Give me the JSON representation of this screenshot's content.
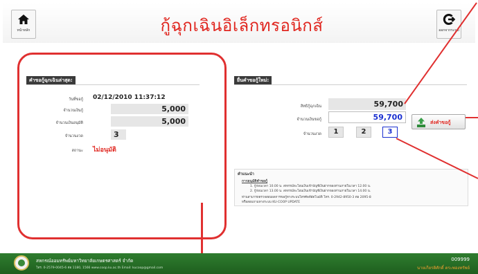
{
  "header": {
    "title": "กู้ฉุกเฉินอิเล็กทรอนิกส์",
    "home_label": "หน้าหลัก",
    "logout_label": "ออกจากระบบ"
  },
  "latest": {
    "panel_title": "คำขอกู้ฉุกเฉินล่าสุด:",
    "date_label": "วันที่ขอกู้",
    "date_value": "02/12/2010 11:37:12",
    "amount_label": "จำนวนเงินกู้",
    "amount_value": "5,000",
    "approved_label": "จำนวนเงินอนุมัติ",
    "approved_value": "5,000",
    "installments_label": "จำนวนงวด",
    "installments_value": "3",
    "status_label": "สถานะ",
    "status_value": "ไม่อนุมัติ"
  },
  "new_request": {
    "panel_title": "ยื่นคำขอกู้ใหม่:",
    "entitlement_label": "สิทธิกู้ฉุกเฉิน",
    "entitlement_value": "59,700",
    "request_amount_label": "จำนวนเงินขอกู้",
    "request_amount_value": "59,700",
    "installments_label": "จำนวนงวด",
    "installment_options": [
      "1",
      "2",
      "3"
    ],
    "selected_installment": "3",
    "submit_label": "ส่งคำขอกู้"
  },
  "notes": {
    "heading": "คำแนะนำ",
    "subheading": "การอนุมัติคำขอกู้",
    "line1": "1. กู้ก่อนเวลา 10.00 น. สหกรณ์จะโอนเงินเข้าบัญชีเงินฝากของท่านภายในเวลา 12.00 น.",
    "line2": "2. กู้ก่อนเวลา 13.00 น. สหกรณ์จะโอนเงินเข้าบัญชีเงินฝากของท่านภายในเวลา 14.00 น.",
    "line3": "ท่านสามารถตรวจสอบผลการขอกู้ทางระบบโทรศัพท์อัตโนมัติ โทร. 0-2942-8950-3 ต่อ 2095-8",
    "line4": "หรือสอบถามทางระบบ KU-COOP UPDATE"
  },
  "footer": {
    "org_name": "สหกรณ์ออมทรัพย์มหาวิทยาลัยเกษตรศาสตร์ จำกัด",
    "contact": "โทร. 0-2579-0045-6 ต่อ 1180, 1566  www.coop.ku.ac.th  Email: kucoop@gmail.com",
    "member_id": "009999",
    "member_name": "นายเกียรติศักดิ์ ตระพองทรัพย์"
  },
  "colors": {
    "title_red": "#e0261f",
    "panel_header": "#3a3a3a",
    "blue_value": "#1a2fd0",
    "status_red": "#e0261f",
    "footer_green": "#2f7d2f"
  }
}
